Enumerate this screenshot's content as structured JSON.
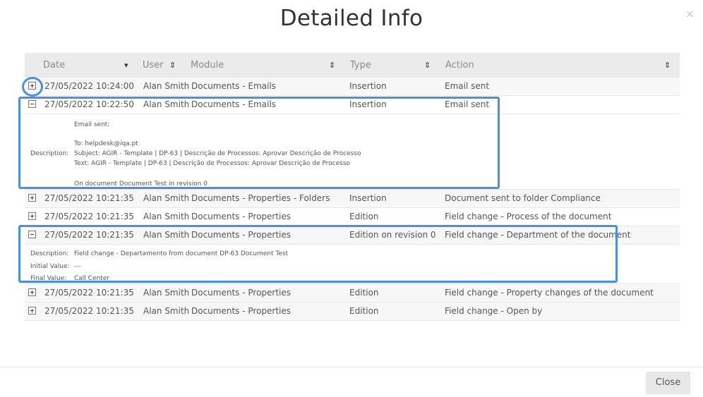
{
  "dialog": {
    "title": "Detailed Info",
    "close_x": "×",
    "close_button": "Close"
  },
  "table": {
    "headers": {
      "date": "Date",
      "date_sort": "▾",
      "user": "User",
      "user_sort": "⇕",
      "module": "Module",
      "module_sort": "⇕",
      "type": "Type",
      "type_sort": "⇕",
      "action": "Action",
      "action_sort": "⇕"
    },
    "rows": [
      {
        "toggle": "+",
        "date": "27/05/2022 10:24:00",
        "user": "Alan Smith",
        "module": "Documents - Emails",
        "type": "Insertion",
        "action": "Email sent"
      },
      {
        "toggle": "−",
        "date": "27/05/2022 10:22:50",
        "user": "Alan Smith",
        "module": "Documents - Emails",
        "type": "Insertion",
        "action": "Email sent"
      },
      {
        "toggle": "+",
        "date": "27/05/2022 10:21:35",
        "user": "Alan Smith",
        "module": "Documents - Properties - Folders",
        "type": "Insertion",
        "action": "Document sent to folder Compliance"
      },
      {
        "toggle": "+",
        "date": "27/05/2022 10:21:35",
        "user": "Alan Smith",
        "module": "Documents - Properties",
        "type": "Edition",
        "action": "Field change - Process of the document"
      },
      {
        "toggle": "−",
        "date": "27/05/2022 10:21:35",
        "user": "Alan Smith",
        "module": "Documents - Properties",
        "type": "Edition on revision 0",
        "action": "Field change - Department of the document"
      },
      {
        "toggle": "+",
        "date": "27/05/2022 10:21:35",
        "user": "Alan Smith",
        "module": "Documents - Properties",
        "type": "Edition",
        "action": "Field change - Property changes of the document"
      },
      {
        "toggle": "+",
        "date": "27/05/2022 10:21:35",
        "user": "Alan Smith",
        "module": "Documents - Properties",
        "type": "Edition",
        "action": "Field change - Open by"
      }
    ],
    "detail1": {
      "label": "Description:",
      "line1": "Email sent:",
      "line2": "To: helpdesk@iqa.pt",
      "line3": "Subject: AGIR - Template | DP-63 | Descrição de Processos: Aprovar Descrição de Processo",
      "line4": "Text: AGIR - Template | DP-63 | Descrição de Processos: Aprovar Descrição de Processo",
      "line5": "On document Document Test in revision 0"
    },
    "detail2": {
      "desc_label": "Description:",
      "desc_value": "Field change - Departamento from document DP-63 Document Test",
      "initial_label": "Initial Value:",
      "initial_value": "---",
      "final_label": "Final Value:",
      "final_value": "Call Center"
    }
  },
  "highlight_color": "#4a90e2"
}
